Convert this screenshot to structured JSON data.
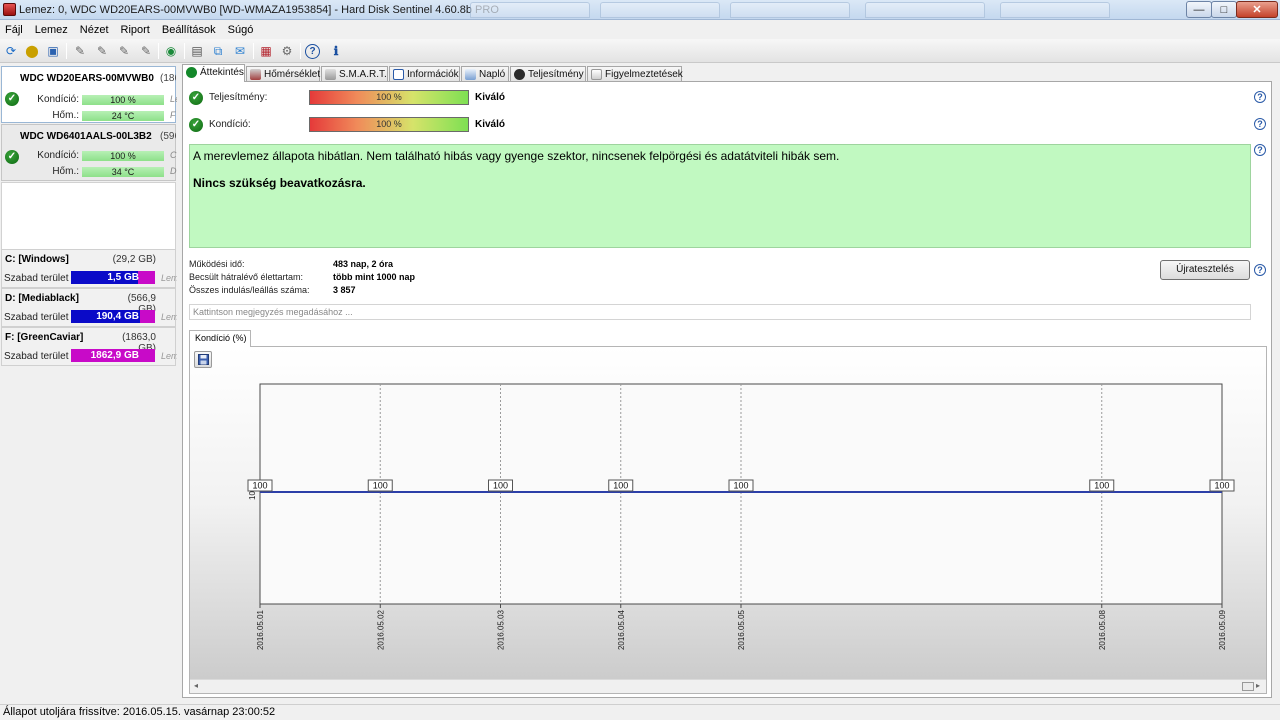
{
  "window": {
    "title": "Lemez: 0, WDC WD20EARS-00MVWB0 [WD-WMAZA1953854]  -  Hard Disk Sentinel 4.60.8b PRO",
    "controls": {
      "minimize": "—",
      "maximize": "□",
      "close": "✕"
    }
  },
  "menu": [
    "Fájl",
    "Lemez",
    "Nézet",
    "Riport",
    "Beállítások",
    "Súgó"
  ],
  "toolbar_icons": [
    "refresh-icon",
    "detect-icon",
    "monitor-icon",
    "test-icon",
    "test2-icon",
    "test3-icon",
    "test4-icon",
    "globe-icon",
    "report-icon",
    "copy-icon",
    "send-icon",
    "alert-icon",
    "settings-icon",
    "help-icon",
    "info-icon"
  ],
  "disks": [
    {
      "name": "WDC WD20EARS-00MVWB0",
      "size": "(186",
      "condition_label": "Kondíció:",
      "condition": "100 %",
      "condition_pct": 100,
      "temp_label": "Hőm.:",
      "temp": "24 °C",
      "cut1": "Le",
      "cut2": "F",
      "selected": true
    },
    {
      "name": "WDC WD6401AALS-00L3B2",
      "size": "(596",
      "condition_label": "Kondíció:",
      "condition": "100 %",
      "condition_pct": 100,
      "temp_label": "Hőm.:",
      "temp": "34 °C",
      "cut1": "C",
      "cut2": "D",
      "selected": false
    }
  ],
  "volumes": [
    {
      "name": "C: [Windows]",
      "capacity": "(29,2 GB)",
      "free_label": "Szabad terület",
      "free": "1,5 GB",
      "cut": "Lem",
      "color": "#0a0ac8",
      "accent": "#c80ac8"
    },
    {
      "name": "D: [Mediablack]",
      "capacity": "(566,9 GB)",
      "free_label": "Szabad terület",
      "free": "190,4 GB",
      "cut": "Lem",
      "color": "#0a0ac8",
      "accent": "#c80ac8"
    },
    {
      "name": "F: [GreenCaviar]",
      "capacity": "(1863,0 GB)",
      "free_label": "Szabad terület",
      "free": "1862,9 GB",
      "cut": "Lem",
      "color": "#c80ac8",
      "accent": "#c80ac8"
    }
  ],
  "tabs": [
    "Áttekintés",
    "Hőmérséklet",
    "S.M.A.R.T.",
    "Információk",
    "Napló",
    "Teljesítmény",
    "Figyelmeztetések"
  ],
  "overview": {
    "performance_label": "Teljesítmény:",
    "performance_value": "100 %",
    "performance_pct": 100,
    "performance_word": "Kiváló",
    "condition_label": "Kondíció:",
    "condition_value": "100 %",
    "condition_pct": 100,
    "condition_word": "Kiváló",
    "help": "?",
    "status_line1": "A merevlemez állapota hibátlan. Nem található hibás vagy gyenge szektor, nincsenek felpörgési és adatátviteli hibák sem.",
    "status_line2": "Nincs szükség beavatkozásra.",
    "power_on_label": "Működési idő:",
    "power_on_value": "483 nap, 2 óra",
    "lifetime_label": "Becsült hátralévő élettartam:",
    "lifetime_value": "több mint 1000 nap",
    "starts_label": "Összes indulás/leállás száma:",
    "starts_value": "3 857",
    "retest_label": "Újratesztelés",
    "note_placeholder": "Kattintson megjegyzés megadásához ..."
  },
  "chart_tab_label": "Kondíció  (%)",
  "chart_data": {
    "type": "line",
    "x": [
      "2016.05.01",
      "2016.05.02",
      "2016.05.03",
      "2016.05.04",
      "2016.05.05",
      "2016.05.08",
      "2016.05.09"
    ],
    "series": [
      {
        "values": [
          100,
          100,
          100,
          100,
          100,
          100,
          100
        ]
      }
    ],
    "ylabel": "",
    "ytick": "100",
    "line_color": "#2c3fa8"
  },
  "statusbar": "Állapot utoljára frissítve: 2016.05.15. vasárnap 23:00:52"
}
